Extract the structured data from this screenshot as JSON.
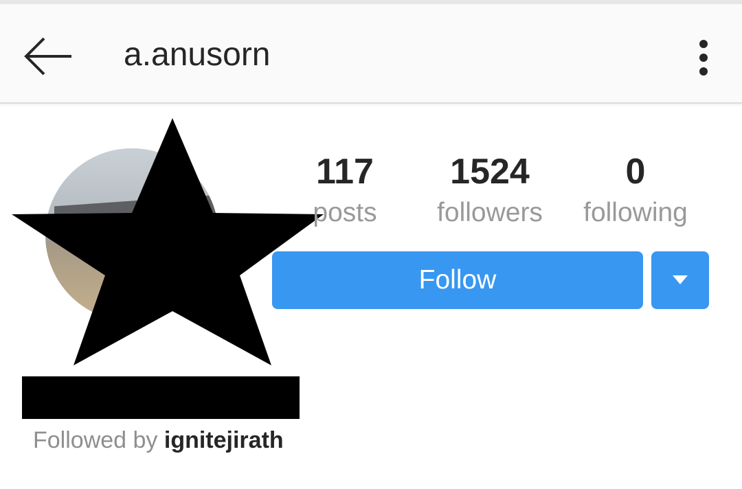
{
  "header": {
    "title": "a.anusorn",
    "back_icon": "arrow-left-icon",
    "menu_icon": "more-vertical-icon"
  },
  "profile": {
    "stats": [
      {
        "value": "117",
        "label": "posts"
      },
      {
        "value": "1524",
        "label": "followers"
      },
      {
        "value": "0",
        "label": "following"
      }
    ],
    "follow_label": "Follow",
    "dropdown_icon": "caret-down-icon",
    "followed_by_prefix": "Followed by",
    "followed_by_user": "ignitejirath"
  },
  "colors": {
    "accent": "#3897f0",
    "text": "#262626",
    "muted": "#999999",
    "appbar": "#fafafa"
  }
}
